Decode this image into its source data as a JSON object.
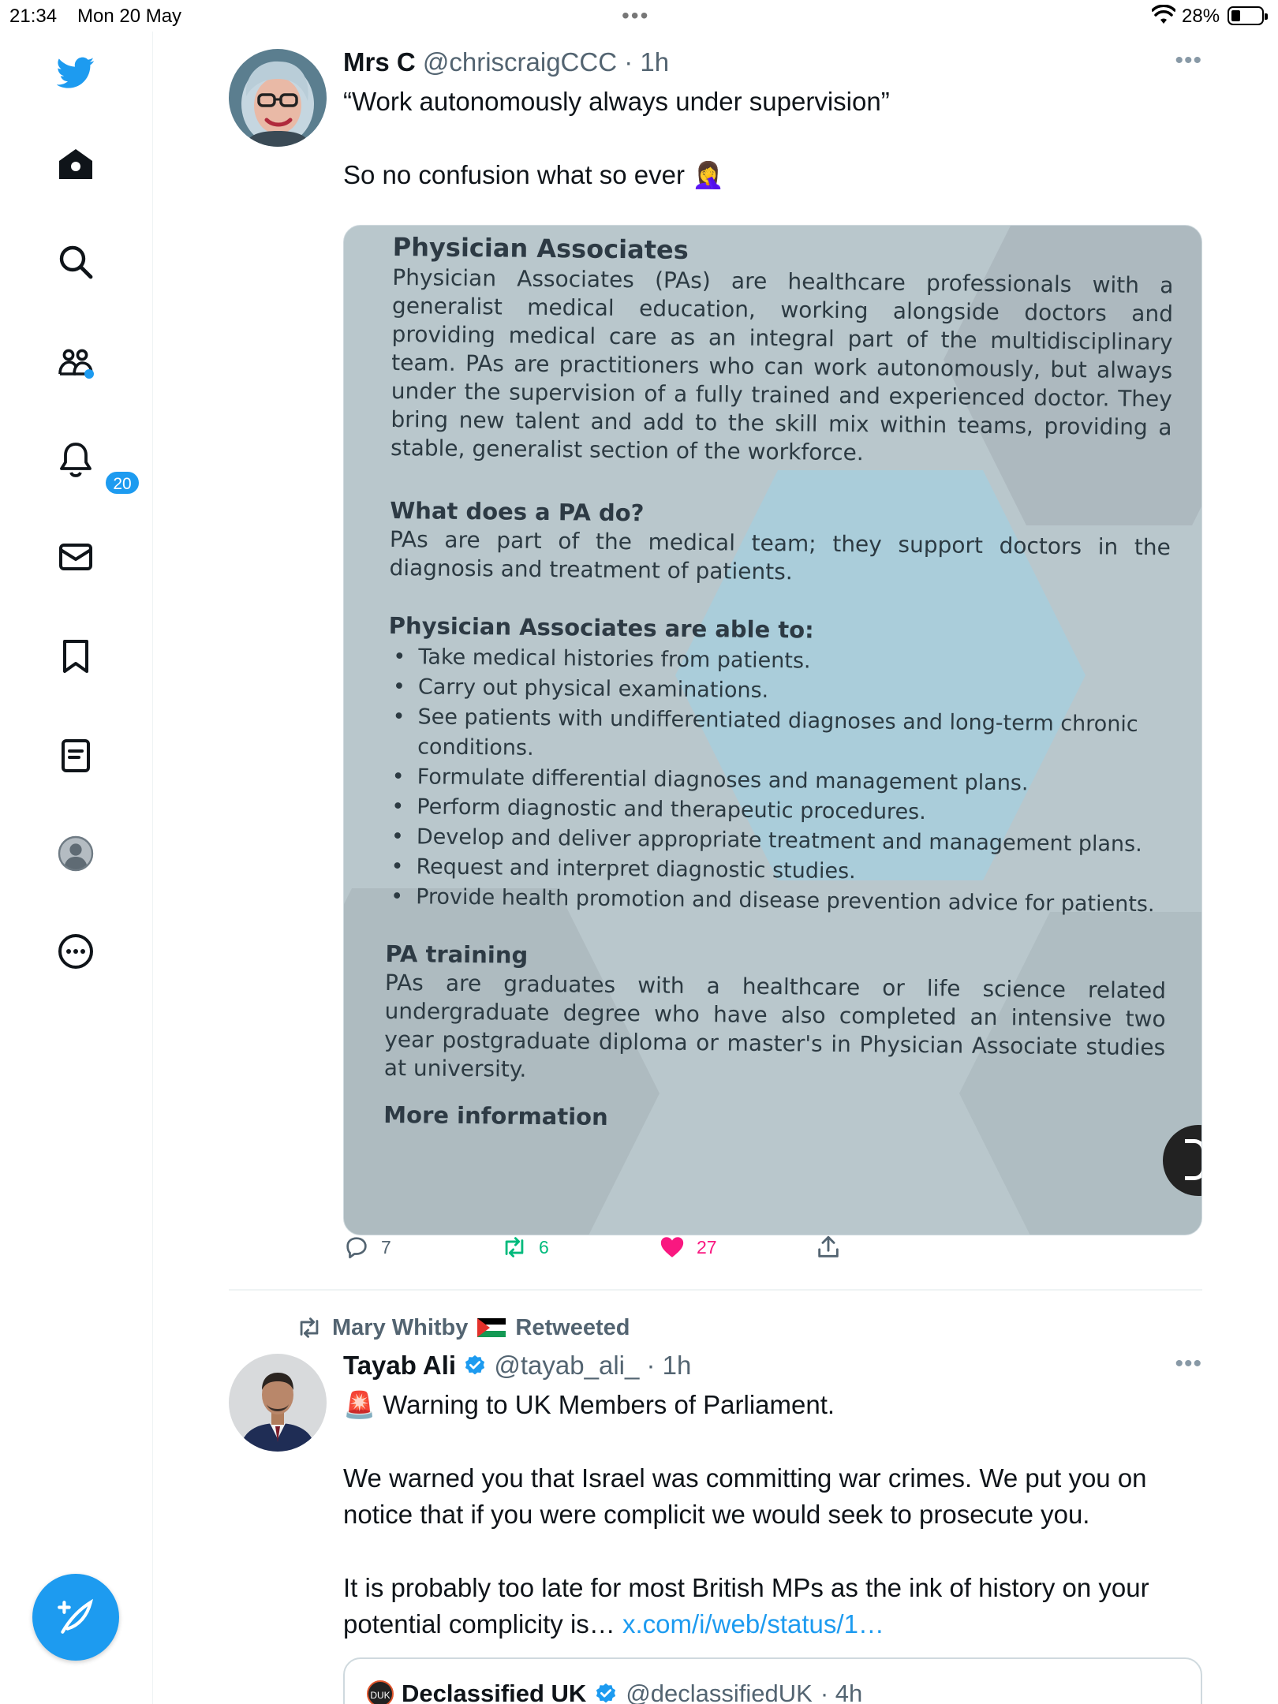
{
  "status_bar": {
    "time": "21:34",
    "date": "Mon 20 May",
    "battery": "28%"
  },
  "sidebar": {
    "items": [
      {
        "icon": "twitter-bird-icon"
      },
      {
        "icon": "home-icon"
      },
      {
        "icon": "search-icon"
      },
      {
        "icon": "communities-icon"
      },
      {
        "icon": "notifications-bell-icon",
        "badge": "20"
      },
      {
        "icon": "messages-envelope-icon"
      },
      {
        "icon": "bookmarks-icon"
      },
      {
        "icon": "lists-icon"
      },
      {
        "icon": "profile-icon"
      },
      {
        "icon": "more-options-icon"
      }
    ],
    "compose_icon": "compose-feather-icon"
  },
  "tweets": [
    {
      "name": "Mrs C",
      "handle": "@chriscraigCCC",
      "time": "· 1h",
      "text_line1": "“Work autonomously always under supervision”",
      "text_line2": "So no confusion what so ever 🤦‍♀️",
      "image": {
        "heading1": "Physician Associates",
        "para1": "Physician Associates (PAs) are healthcare professionals with a generalist medical education, working alongside doctors and providing medical care as an integral part of the multidisciplinary team. PAs are practitioners who can work autonomously, but always under the supervision of a fully trained and experienced doctor. They bring new talent and add to the skill mix within teams, providing a stable, generalist section of the workforce.",
        "heading2": "What does a PA do?",
        "para2": "PAs are part of the medical team; they support doctors in the diagnosis and treatment of patients.",
        "heading3": "Physician Associates are able to:",
        "bullets": [
          "Take medical histories from patients.",
          "Carry out physical examinations.",
          "See patients with undifferentiated diagnoses and long-term chronic conditions.",
          "Formulate differential diagnoses and management plans.",
          "Perform diagnostic and therapeutic procedures.",
          "Develop and deliver appropriate treatment and management plans.",
          "Request and interpret diagnostic studies.",
          "Provide health promotion and disease prevention advice for patients."
        ],
        "heading4": "PA training",
        "para4": "PAs are graduates with a healthcare or life science related undergraduate degree who have also completed an intensive two year postgraduate diploma or master's in Physician Associate studies at university.",
        "heading5": "More information"
      },
      "replies": "7",
      "retweets": "6",
      "likes": "27"
    },
    {
      "retweeted_by": "Mary Whitby",
      "retweeted_label": "Retweeted",
      "name": "Tayab Ali",
      "handle": "@tayab_ali_",
      "time": "· 1h",
      "text_line1": "🚨 Warning to UK Members of Parliament.",
      "text_line2": "We warned you that Israel was committing war crimes. We put you on notice that if you were complicit we would seek to prosecute you.",
      "text_line3": "It is probably too late for most British MPs as the ink of history on your potential complicity is… ",
      "link": "x.com/i/web/status/1…",
      "quote": {
        "name": "Declassified UK",
        "handle": "@declassifiedUK",
        "time": "· 4h"
      }
    }
  ],
  "colors": {
    "accent": "#1d9bf0",
    "like": "#f91880",
    "retweet": "#00ba7c",
    "muted": "#536471"
  }
}
